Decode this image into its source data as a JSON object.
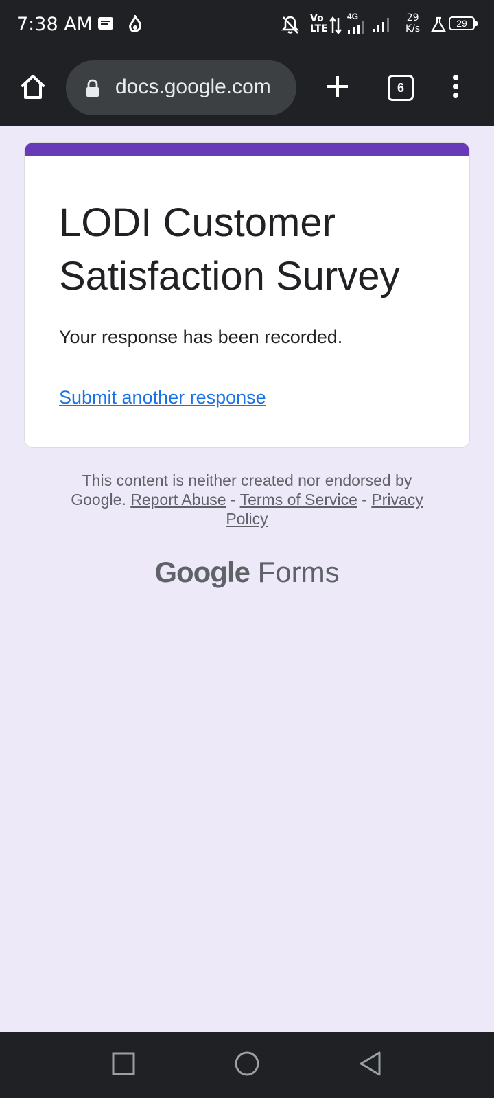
{
  "status_bar": {
    "time": "7:38 AM",
    "network_type": "4G",
    "volte_top": "Vo",
    "volte_bottom": "LTE",
    "speed_value": "29",
    "speed_unit": "K/s",
    "battery": "29",
    "icons": [
      "message-icon",
      "flame-icon",
      "bell-off-icon",
      "data-arrows-icon",
      "signal-icon",
      "signal-icon-2",
      "lab-flask-icon"
    ]
  },
  "browser": {
    "url": "docs.google.com",
    "tab_count": "6",
    "icons": [
      "home-icon",
      "lock-icon",
      "add-tab-icon",
      "tab-switcher-icon",
      "more-vert-icon"
    ]
  },
  "form": {
    "title": "LODI Customer Satisfaction Survey",
    "confirmation": "Your response has been recorded.",
    "submit_another": "Submit another response",
    "accent_color": "#673ab7"
  },
  "footer": {
    "disclaimer_text": "This content is neither created nor endorsed by Google.",
    "report_abuse": "Report Abuse",
    "sep1": " - ",
    "terms": "Terms of Service",
    "sep2": " - ",
    "privacy": "Privacy Policy",
    "logo_google": "Google",
    "logo_forms": "Forms"
  },
  "nav_bar": {
    "icons": [
      "recent-apps-icon",
      "home-circle-icon",
      "back-icon"
    ]
  }
}
